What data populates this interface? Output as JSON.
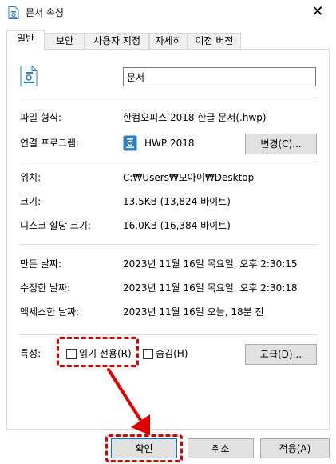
{
  "window": {
    "title": "문서 속성",
    "close_glyph": "✕"
  },
  "tabs": [
    {
      "label": "일반",
      "active": true
    },
    {
      "label": "보안",
      "active": false
    },
    {
      "label": "사용자 지정",
      "active": false
    },
    {
      "label": "자세히",
      "active": false
    },
    {
      "label": "이전 버전",
      "active": false
    }
  ],
  "general": {
    "file_name": "문서",
    "file_type": {
      "label": "파일 형식:",
      "value": "한컴오피스 2018 한글 문서(.hwp)"
    },
    "opens_with": {
      "label": "연결 프로그램:",
      "value": "HWP 2018",
      "change_button": "변경(C)..."
    },
    "location": {
      "label": "위치:",
      "value": "C:₩Users₩모아이₩Desktop"
    },
    "size": {
      "label": "크기:",
      "value": "13.5KB (13,824 바이트)"
    },
    "size_on_disk": {
      "label": "디스크 할당 크기:",
      "value": "16.0KB (16,384 바이트)"
    },
    "created": {
      "label": "만든 날짜:",
      "value": "2023년 11월 16일 목요일, 오후 2:30:15"
    },
    "modified": {
      "label": "수정한 날짜:",
      "value": "2023년 11월 16일 목요일, 오후 2:30:18"
    },
    "accessed": {
      "label": "액세스한 날짜:",
      "value": "2023년 11월 16일 오늘, 18분 전"
    },
    "attributes": {
      "label": "특성:",
      "readonly_label": "읽기 전용(R)",
      "readonly_checked": false,
      "hidden_label": "숨김(H)",
      "hidden_checked": false,
      "advanced_button": "고급(D)..."
    }
  },
  "footer": {
    "ok": "확인",
    "cancel": "취소",
    "apply": "적용(A)"
  },
  "icons": {
    "title": "hwp-document-icon",
    "file": "hwp-document-icon",
    "program": "hwp-app-icon",
    "close": "close-icon"
  },
  "colors": {
    "annotation": "#e00000",
    "focus": "#0078d7",
    "hwp_blue": "#2c7fc4"
  }
}
